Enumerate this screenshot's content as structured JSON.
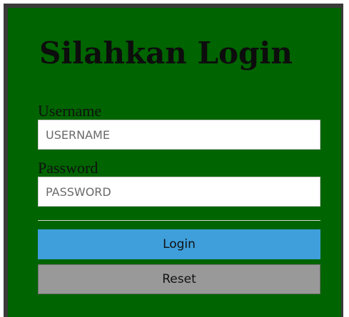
{
  "login_form": {
    "title": "Silahkan Login",
    "username_label": "Username",
    "username_placeholder": "USERNAME",
    "password_label": "Password",
    "password_placeholder": "PASSWORD",
    "login_button": "Login",
    "reset_button": "Reset"
  },
  "colors": {
    "panel_background": "#006400",
    "login_button": "#3e9fdb",
    "reset_button": "#999999"
  }
}
